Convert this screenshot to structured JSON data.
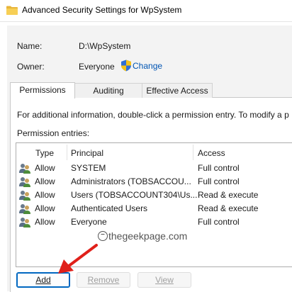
{
  "window": {
    "title": "Advanced Security Settings for WpSystem",
    "icon": "folder-icon"
  },
  "name": {
    "label": "Name:",
    "value": "D:\\WpSystem"
  },
  "owner": {
    "label": "Owner:",
    "value": "Everyone",
    "change_label": "Change"
  },
  "tabs": [
    {
      "label": "Permissions",
      "active": true
    },
    {
      "label": "Auditing",
      "active": false
    },
    {
      "label": "Effective Access",
      "active": false
    }
  ],
  "info_text": "For additional information, double-click a permission entry. To modify a p",
  "entries_label": "Permission entries:",
  "columns": {
    "type": "Type",
    "principal": "Principal",
    "access": "Access"
  },
  "entries": [
    {
      "type": "Allow",
      "principal": "SYSTEM",
      "access": "Full control"
    },
    {
      "type": "Allow",
      "principal": "Administrators (TOBSACCOU...",
      "access": "Full control"
    },
    {
      "type": "Allow",
      "principal": "Users (TOBSACCOUNT304\\Us...",
      "access": "Read & execute"
    },
    {
      "type": "Allow",
      "principal": "Authenticated Users",
      "access": "Read & execute"
    },
    {
      "type": "Allow",
      "principal": "Everyone",
      "access": "Full control"
    }
  ],
  "watermark": "thegeekpage.com",
  "buttons": {
    "add": {
      "label": "Add",
      "enabled": true
    },
    "remove": {
      "label": "Remove",
      "enabled": false
    },
    "view": {
      "label": "View",
      "enabled": false
    }
  },
  "colors": {
    "link": "#0055b3",
    "accent": "#0067c0",
    "arrow": "#e0201a"
  }
}
